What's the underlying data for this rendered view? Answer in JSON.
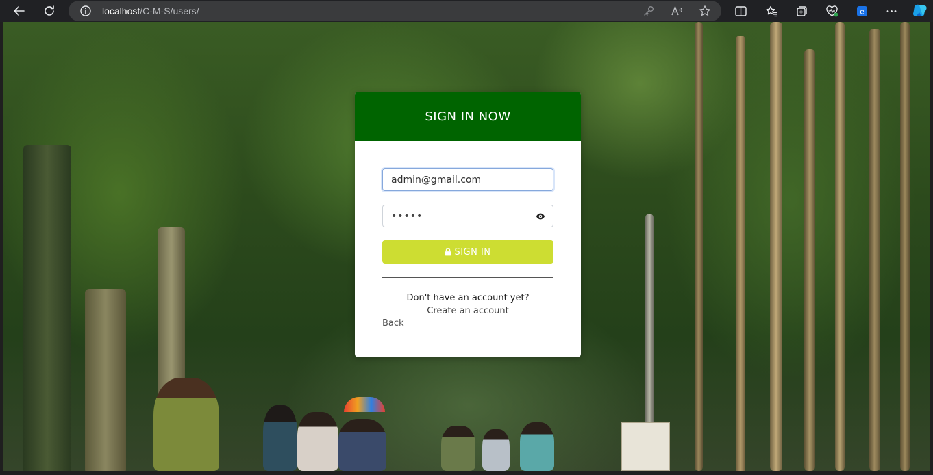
{
  "browser": {
    "url_host": "localhost",
    "url_path": "/C-M-S/users/"
  },
  "login": {
    "title": "SIGN IN NOW",
    "email_value": "admin@gmail.com",
    "password_value": "•••••",
    "signin_label": "SIGN IN",
    "no_account_text": "Don't have an account yet?",
    "create_account_label": "Create an account",
    "back_label": "Back"
  },
  "colors": {
    "header_green": "#006400",
    "signin_lime": "#cddd32"
  }
}
